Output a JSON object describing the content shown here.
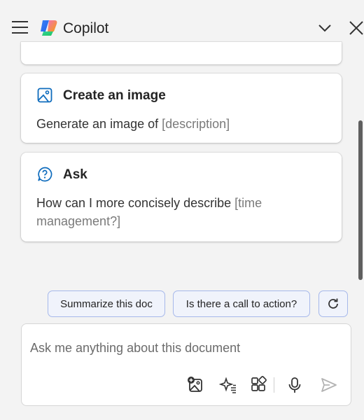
{
  "header": {
    "title": "Copilot",
    "icons": {
      "menu": "hamburger-menu-icon",
      "logo": "copilot-logo",
      "collapse": "chevron-down-icon",
      "close": "close-icon"
    }
  },
  "cards": [
    {
      "icon": "image-icon",
      "title": "Create an image",
      "body": "Generate an image of ",
      "placeholder": "[description]"
    },
    {
      "icon": "question-icon",
      "title": "Ask",
      "body": "How can I more concisely describe ",
      "placeholder": "[time management?]"
    }
  ],
  "suggestions": [
    {
      "label": "Summarize this doc"
    },
    {
      "label": "Is there a call to action?"
    }
  ],
  "refresh_icon": "refresh-icon",
  "composer": {
    "placeholder": "Ask me anything about this document",
    "tools": [
      "add-image-icon",
      "sparkle-prompts-icon",
      "apps-grid-icon",
      "microphone-icon",
      "send-icon"
    ]
  },
  "colors": {
    "background": "#f3f3f3",
    "card": "#ffffff",
    "accent": "#0f6cbd",
    "chip_border": "#a6b8ea",
    "chip_bg": "#f0f3fb"
  }
}
